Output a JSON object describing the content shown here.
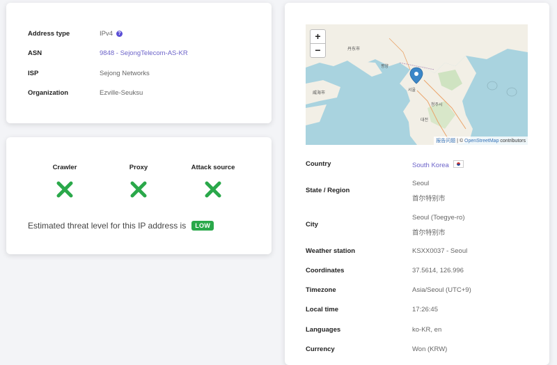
{
  "info": {
    "rows": [
      {
        "label": "Address type",
        "value": "IPv4"
      },
      {
        "label": "ASN",
        "value": "9848 - SejongTelecom-AS-KR"
      },
      {
        "label": "ISP",
        "value": "Sejong Networks"
      },
      {
        "label": "Organization",
        "value": "Ezville-Seuksu"
      }
    ],
    "help_glyph": "?"
  },
  "threat": {
    "columns": [
      "Crawler",
      "Proxy",
      "Attack source"
    ],
    "status_icon": "x-mark-icon",
    "status_color": "#2aa84a",
    "text": "Estimated threat level for this IP address is",
    "level": "LOW"
  },
  "map": {
    "zoom_in": "+",
    "zoom_out": "−",
    "attribution_report": "报告问题",
    "attribution_sep": " | © ",
    "attribution_link": "OpenStreetMap",
    "attribution_tail": " contributors",
    "labels": {
      "seoul": "서울",
      "city1": "청주시",
      "city2": "대전",
      "city3": "평양",
      "city4": "威海市",
      "city5": "丹东市"
    }
  },
  "geo": {
    "country_label": "Country",
    "country_value": "South Korea",
    "state_label": "State / Region",
    "state_value": "Seoul",
    "state_sub": "首尔特别市",
    "city_label": "City",
    "city_value": "Seoul (Toegye-ro)",
    "city_sub": "首尔特别市",
    "weather_label": "Weather station",
    "weather_value": "KSXX0037 - Seoul",
    "coords_label": "Coordinates",
    "coords_value": "37.5614, 126.996",
    "tz_label": "Timezone",
    "tz_value": "Asia/Seoul (UTC+9)",
    "time_label": "Local time",
    "time_value": "17:26:45",
    "lang_label": "Languages",
    "lang_value": "ko-KR, en",
    "currency_label": "Currency",
    "currency_value": "Won (KRW)"
  },
  "colors": {
    "accent": "#6c63c9",
    "low_badge": "#2aa84a",
    "map_water": "#a9d3df",
    "map_land": "#f2efe6"
  }
}
